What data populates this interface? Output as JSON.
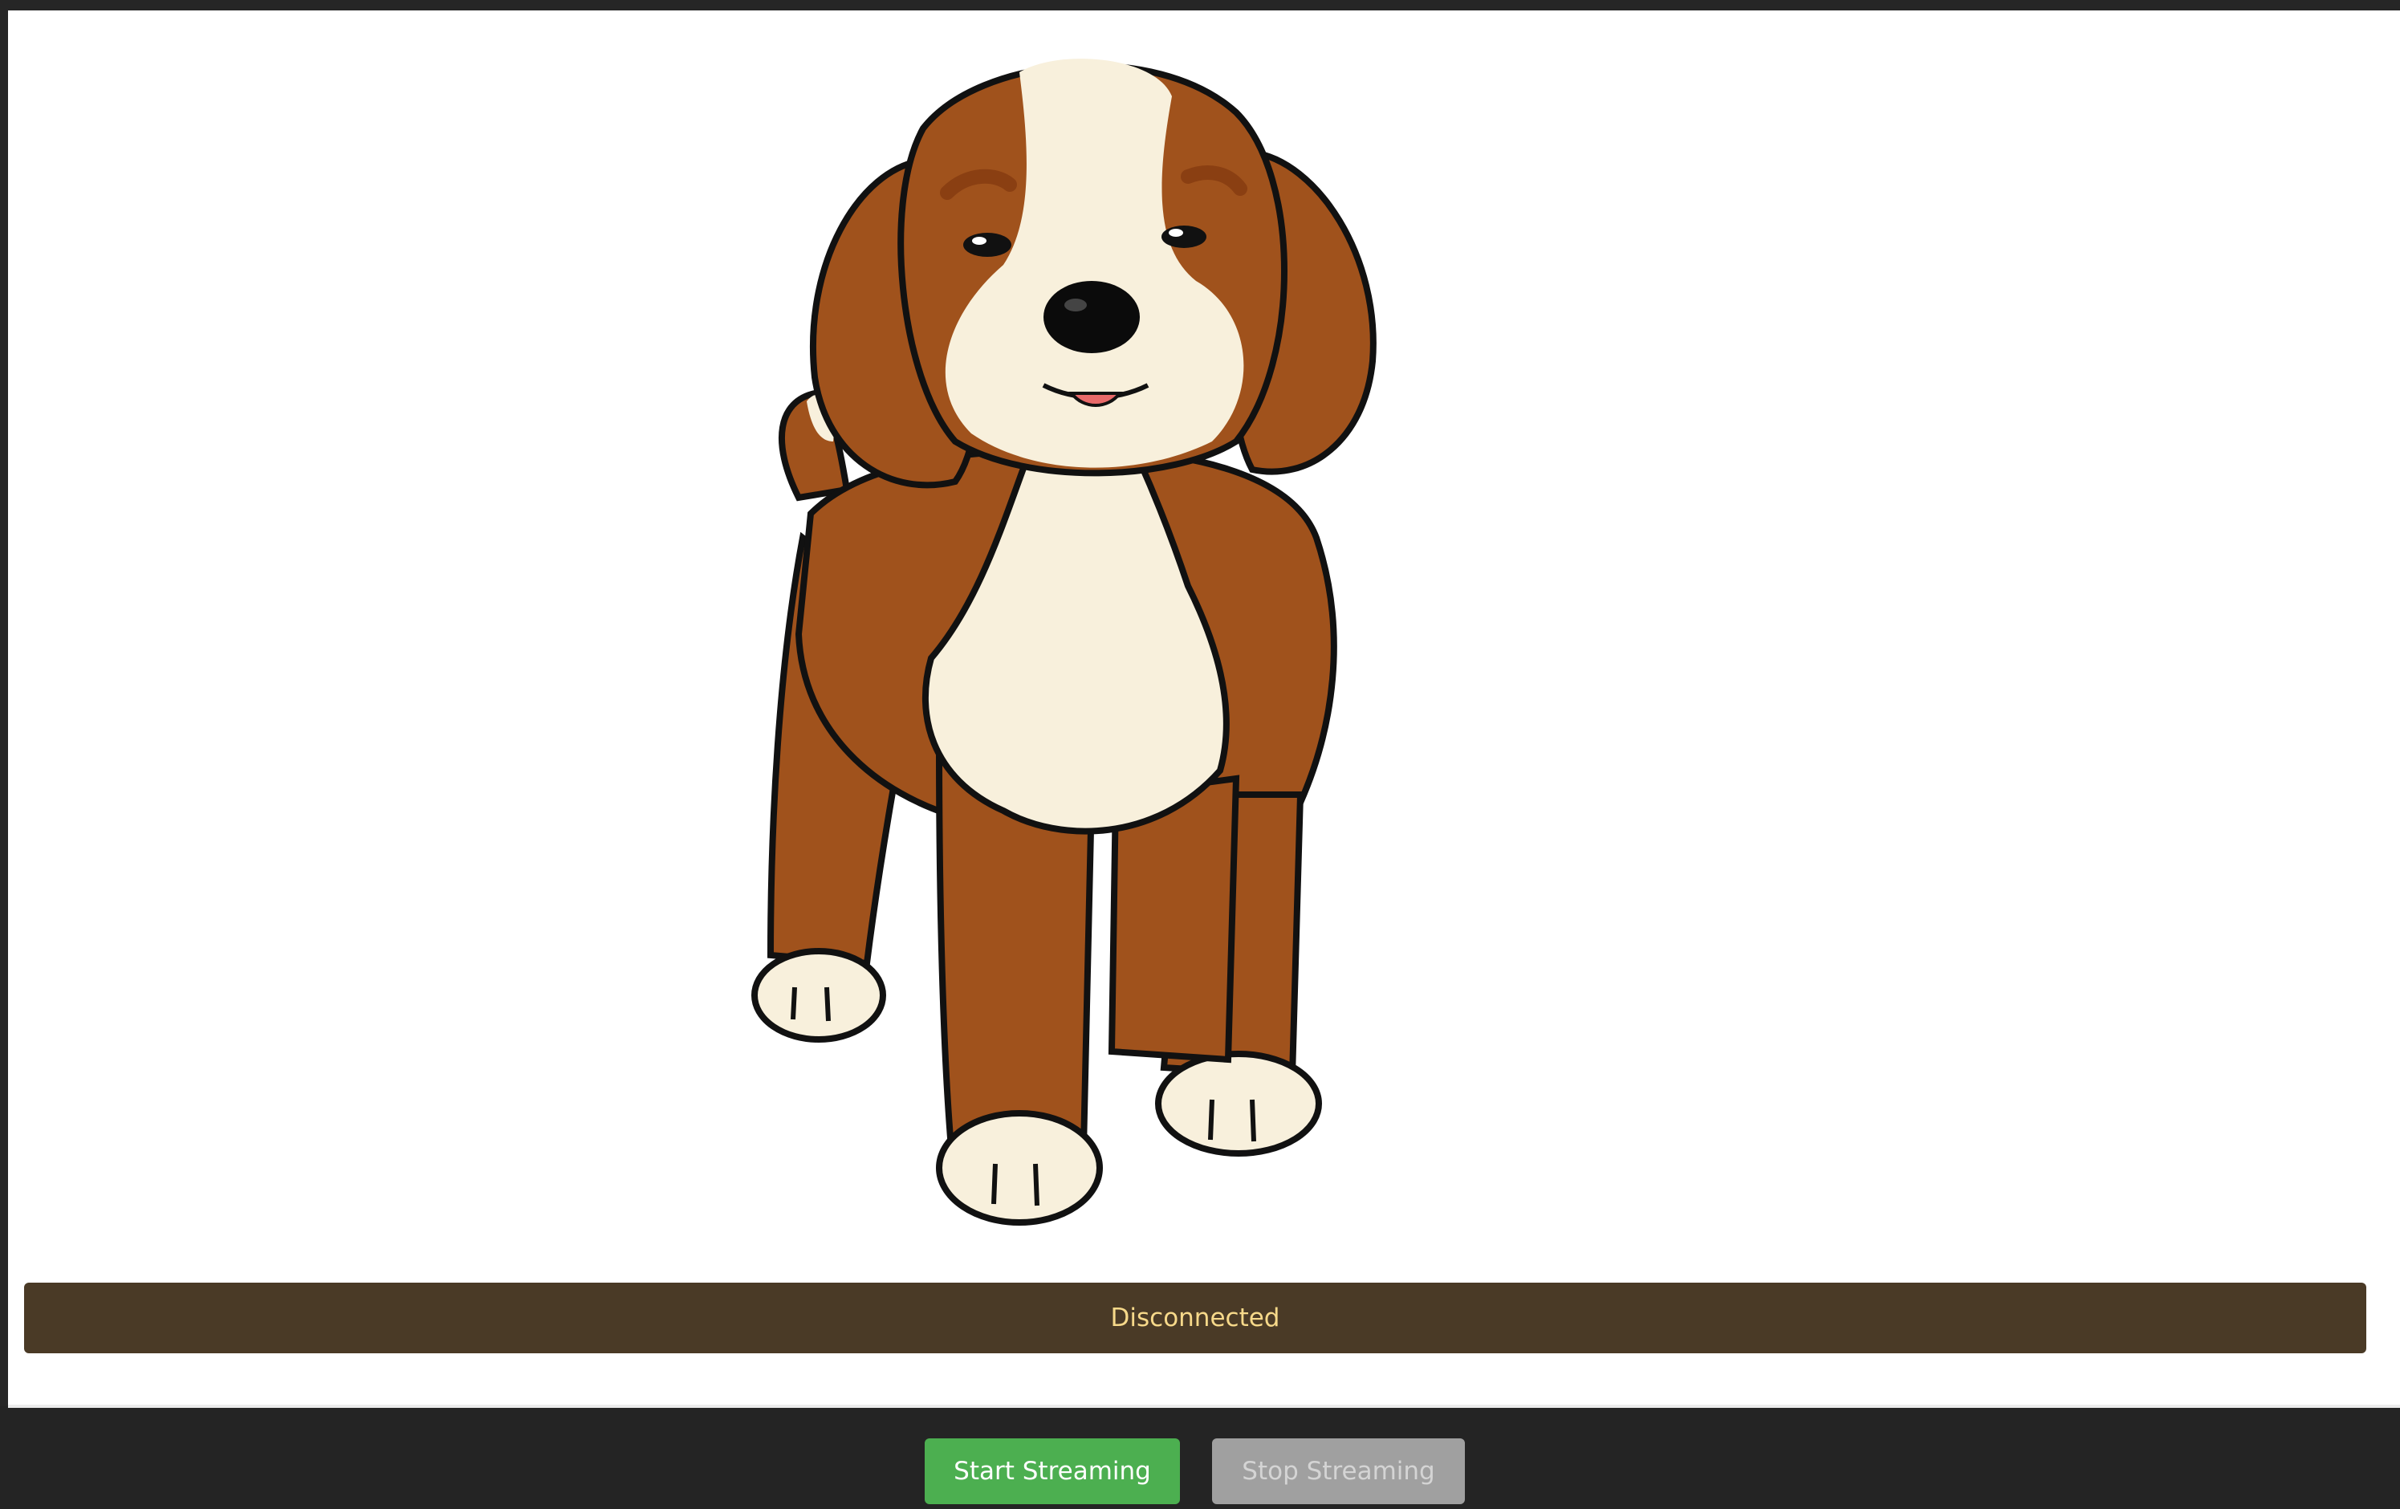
{
  "video": {
    "image_icon": "puppy-illustration"
  },
  "status": {
    "text": "Disconnected",
    "background_color": "#4a3a26",
    "text_color": "#f7d98a"
  },
  "controls": {
    "start_label": "Start Streaming",
    "start_color": "#4caf50",
    "stop_label": "Stop Streaming",
    "stop_color": "#a0a0a0",
    "stop_disabled": true
  }
}
